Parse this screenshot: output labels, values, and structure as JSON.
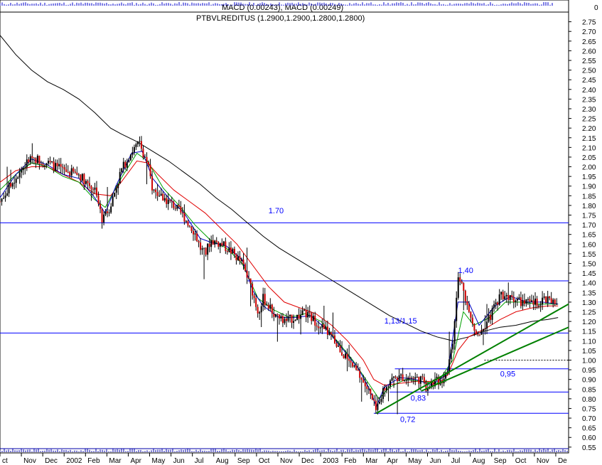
{
  "chart_data": {
    "type": "candlestick",
    "title": "PTBVLREDITUS (1.2900,1.2900,1.2800,1.2800)",
    "top_pane_label": "MACD (0.00243), MACD (0.00249)",
    "top_pane_zero_label": "0",
    "y_ticks": [
      "2.75",
      "2.70",
      "2.65",
      "2.60",
      "2.55",
      "2.50",
      "2.45",
      "2.40",
      "2.35",
      "2.30",
      "2.25",
      "2.20",
      "2.15",
      "2.10",
      "2.05",
      "2.00",
      "1.95",
      "1.90",
      "1.85",
      "1.80",
      "1.75",
      "1.70",
      "1.65",
      "1.60",
      "1.55",
      "1.50",
      "1.45",
      "1.40",
      "1.35",
      "1.30",
      "1.25",
      "1.20",
      "1.15",
      "1.10",
      "1.05",
      "1.00",
      "0.95",
      "0.90",
      "0.85",
      "0.80",
      "0.75",
      "0.70",
      "0.65",
      "0.60",
      "0.55"
    ],
    "ylim": [
      0.52,
      2.8
    ],
    "x_labels": [
      "Oct",
      "Nov",
      "Dec",
      "2002",
      "Feb",
      "Mar",
      "Apr",
      "May",
      "Jun",
      "Jul",
      "Aug",
      "Sep",
      "Oct",
      "Nov",
      "Dec",
      "2003",
      "Feb",
      "Mar",
      "Apr",
      "May",
      "Jun",
      "Jul",
      "Aug",
      "Sep",
      "Oct",
      "Nov",
      "Dec"
    ],
    "x_label_display": [
      "ct",
      "Nov",
      "Dec",
      "2002",
      "Feb",
      "Mar",
      "Apr",
      "May",
      "Jun",
      "Jul",
      "Aug",
      "Sep",
      "Oct",
      "Nov",
      "Dec",
      "2003",
      "Feb",
      "Mar",
      "Apr",
      "May",
      "Jun",
      "Jul",
      "Aug",
      "Sep",
      "Oct",
      "Nov",
      "De"
    ],
    "price_path": [
      [
        0,
        1.82
      ],
      [
        3,
        1.95
      ],
      [
        6,
        2.05
      ],
      [
        9,
        2.02
      ],
      [
        12,
        1.98
      ],
      [
        15,
        1.96
      ],
      [
        18,
        1.88
      ],
      [
        19.5,
        1.72
      ],
      [
        21,
        1.8
      ],
      [
        23,
        1.98
      ],
      [
        25,
        2.08
      ],
      [
        26.5,
        2.12
      ],
      [
        28,
        2.02
      ],
      [
        29,
        1.88
      ],
      [
        31,
        1.84
      ],
      [
        33,
        1.8
      ],
      [
        35,
        1.74
      ],
      [
        37,
        1.66
      ],
      [
        38,
        1.58
      ],
      [
        39,
        1.55
      ],
      [
        40,
        1.62
      ],
      [
        42,
        1.6
      ],
      [
        44,
        1.56
      ],
      [
        46,
        1.5
      ],
      [
        48,
        1.35
      ],
      [
        49,
        1.25
      ],
      [
        50,
        1.32
      ],
      [
        52,
        1.24
      ],
      [
        54,
        1.2
      ],
      [
        56,
        1.22
      ],
      [
        58,
        1.24
      ],
      [
        60,
        1.2
      ],
      [
        62,
        1.15
      ],
      [
        64,
        1.08
      ],
      [
        66,
        1.0
      ],
      [
        68,
        0.93
      ],
      [
        70,
        0.84
      ],
      [
        71,
        0.77
      ],
      [
        71.5,
        0.73
      ],
      [
        72,
        0.8
      ],
      [
        74,
        0.9
      ],
      [
        76,
        0.91
      ],
      [
        78,
        0.91
      ],
      [
        80,
        0.9
      ],
      [
        81,
        0.86
      ],
      [
        82,
        0.88
      ],
      [
        84,
        0.9
      ],
      [
        85,
        0.96
      ],
      [
        86,
        1.08
      ],
      [
        87,
        1.42
      ],
      [
        88,
        1.38
      ],
      [
        89,
        1.25
      ],
      [
        90,
        1.16
      ],
      [
        91,
        1.14
      ],
      [
        93,
        1.22
      ],
      [
        95,
        1.34
      ],
      [
        97,
        1.33
      ],
      [
        99,
        1.3
      ],
      [
        101,
        1.29
      ],
      [
        103,
        1.31
      ],
      [
        105,
        1.3
      ],
      [
        106,
        1.28
      ]
    ],
    "moving_averages": [
      {
        "color": "#000000",
        "path": [
          [
            0,
            2.68
          ],
          [
            3,
            2.58
          ],
          [
            6,
            2.5
          ],
          [
            9,
            2.44
          ],
          [
            12,
            2.4
          ],
          [
            15,
            2.35
          ],
          [
            18,
            2.28
          ],
          [
            21,
            2.2
          ],
          [
            23,
            2.17
          ],
          [
            26,
            2.13
          ],
          [
            29,
            2.08
          ],
          [
            32,
            2.03
          ],
          [
            35,
            1.97
          ],
          [
            38,
            1.91
          ],
          [
            41,
            1.84
          ],
          [
            44,
            1.78
          ],
          [
            47,
            1.71
          ],
          [
            50,
            1.64
          ],
          [
            53,
            1.58
          ],
          [
            56,
            1.53
          ],
          [
            59,
            1.48
          ],
          [
            62,
            1.43
          ],
          [
            65,
            1.38
          ],
          [
            68,
            1.33
          ],
          [
            71,
            1.28
          ],
          [
            74,
            1.23
          ],
          [
            77,
            1.19
          ],
          [
            80,
            1.15
          ],
          [
            83,
            1.12
          ],
          [
            86,
            1.1
          ],
          [
            89,
            1.12
          ],
          [
            92,
            1.15
          ],
          [
            95,
            1.17
          ],
          [
            98,
            1.18
          ],
          [
            101,
            1.2
          ],
          [
            104,
            1.21
          ],
          [
            106,
            1.22
          ]
        ]
      },
      {
        "color": "#e00000",
        "path": [
          [
            0,
            1.92
          ],
          [
            3,
            1.98
          ],
          [
            6,
            2.0
          ],
          [
            9,
            2.0
          ],
          [
            12,
            1.96
          ],
          [
            15,
            1.92
          ],
          [
            18,
            1.86
          ],
          [
            21,
            1.85
          ],
          [
            23,
            1.92
          ],
          [
            26,
            2.03
          ],
          [
            28,
            2.02
          ],
          [
            30,
            1.96
          ],
          [
            33,
            1.88
          ],
          [
            36,
            1.82
          ],
          [
            39,
            1.76
          ],
          [
            42,
            1.68
          ],
          [
            45,
            1.6
          ],
          [
            48,
            1.49
          ],
          [
            51,
            1.38
          ],
          [
            54,
            1.3
          ],
          [
            57,
            1.27
          ],
          [
            60,
            1.24
          ],
          [
            63,
            1.18
          ],
          [
            66,
            1.1
          ],
          [
            69,
            1.0
          ],
          [
            71,
            0.9
          ],
          [
            73,
            0.87
          ],
          [
            76,
            0.88
          ],
          [
            79,
            0.89
          ],
          [
            82,
            0.89
          ],
          [
            85,
            0.92
          ],
          [
            87,
            1.05
          ],
          [
            89,
            1.12
          ],
          [
            92,
            1.16
          ],
          [
            95,
            1.21
          ],
          [
            98,
            1.25
          ],
          [
            101,
            1.27
          ],
          [
            104,
            1.28
          ],
          [
            106,
            1.28
          ]
        ]
      },
      {
        "color": "#00a000",
        "path": [
          [
            0,
            1.88
          ],
          [
            3,
            1.96
          ],
          [
            6,
            2.02
          ],
          [
            9,
            2.0
          ],
          [
            12,
            1.95
          ],
          [
            15,
            1.92
          ],
          [
            18,
            1.83
          ],
          [
            20,
            1.79
          ],
          [
            23,
            1.94
          ],
          [
            26,
            2.07
          ],
          [
            28,
            2.03
          ],
          [
            31,
            1.89
          ],
          [
            34,
            1.8
          ],
          [
            37,
            1.7
          ],
          [
            40,
            1.62
          ],
          [
            43,
            1.58
          ],
          [
            46,
            1.5
          ],
          [
            49,
            1.32
          ],
          [
            52,
            1.26
          ],
          [
            55,
            1.22
          ],
          [
            58,
            1.24
          ],
          [
            61,
            1.2
          ],
          [
            64,
            1.1
          ],
          [
            67,
            1.0
          ],
          [
            70,
            0.88
          ],
          [
            72,
            0.8
          ],
          [
            74,
            0.86
          ],
          [
            77,
            0.9
          ],
          [
            80,
            0.89
          ],
          [
            83,
            0.88
          ],
          [
            86,
            1.0
          ],
          [
            88,
            1.25
          ],
          [
            90,
            1.18
          ],
          [
            93,
            1.22
          ],
          [
            96,
            1.3
          ],
          [
            99,
            1.3
          ],
          [
            102,
            1.29
          ],
          [
            106,
            1.29
          ]
        ]
      },
      {
        "color": "#0000c0",
        "path": [
          [
            0,
            1.84
          ],
          [
            3,
            1.96
          ],
          [
            6,
            2.04
          ],
          [
            9,
            2.01
          ],
          [
            12,
            1.96
          ],
          [
            15,
            1.94
          ],
          [
            18,
            1.84
          ],
          [
            20,
            1.76
          ],
          [
            22,
            1.9
          ],
          [
            25,
            2.07
          ],
          [
            27,
            2.08
          ],
          [
            29,
            1.94
          ],
          [
            32,
            1.84
          ],
          [
            35,
            1.76
          ],
          [
            38,
            1.63
          ],
          [
            40,
            1.61
          ],
          [
            43,
            1.59
          ],
          [
            46,
            1.52
          ],
          [
            48,
            1.36
          ],
          [
            50,
            1.28
          ],
          [
            53,
            1.22
          ],
          [
            56,
            1.22
          ],
          [
            59,
            1.23
          ],
          [
            62,
            1.16
          ],
          [
            65,
            1.06
          ],
          [
            68,
            0.96
          ],
          [
            70,
            0.86
          ],
          [
            71.5,
            0.76
          ],
          [
            73,
            0.86
          ],
          [
            76,
            0.91
          ],
          [
            79,
            0.9
          ],
          [
            82,
            0.87
          ],
          [
            85,
            0.93
          ],
          [
            87,
            1.3
          ],
          [
            89,
            1.3
          ],
          [
            91,
            1.18
          ],
          [
            94,
            1.28
          ],
          [
            97,
            1.33
          ],
          [
            100,
            1.3
          ],
          [
            103,
            1.3
          ],
          [
            106,
            1.29
          ]
        ]
      }
    ],
    "horizontal_lines": [
      {
        "value": 1.71,
        "color": "#0000ff",
        "x_start": 0,
        "x_end": 108,
        "label": "1.70",
        "label_x": 51,
        "label_value": 1.76
      },
      {
        "value": 1.41,
        "color": "#0000ff",
        "x_start": 47,
        "x_end": 108,
        "label": "1,40",
        "label_x": 87,
        "label_value": 1.45
      },
      {
        "value": 1.14,
        "color": "#0000ff",
        "x_start": 0,
        "x_end": 108,
        "label": "1,13/1,15",
        "label_x": 73,
        "label_value": 1.19
      },
      {
        "value": 0.955,
        "color": "#0000ff",
        "x_start": 75,
        "x_end": 108,
        "label": "0,95",
        "label_x": 95,
        "label_value": 0.915
      },
      {
        "value": 0.835,
        "color": "#0000ff",
        "x_start": 74,
        "x_end": 108,
        "label": "0,83",
        "label_x": 78,
        "label_value": 0.79
      },
      {
        "value": 0.725,
        "color": "#0000ff",
        "x_start": 71,
        "x_end": 108,
        "label": "0,72",
        "label_x": 76,
        "label_value": 0.68
      }
    ],
    "dashed_lines": [
      {
        "value": 1.0,
        "color": "#000000",
        "x_start": 92,
        "x_end": 108
      }
    ],
    "trend_lines": [
      {
        "color": "#008000",
        "from": [
          71.5,
          0.725
        ],
        "to": [
          108,
          1.29
        ]
      },
      {
        "color": "#008000",
        "from": [
          80,
          0.84
        ],
        "to": [
          108,
          1.17
        ]
      }
    ]
  }
}
